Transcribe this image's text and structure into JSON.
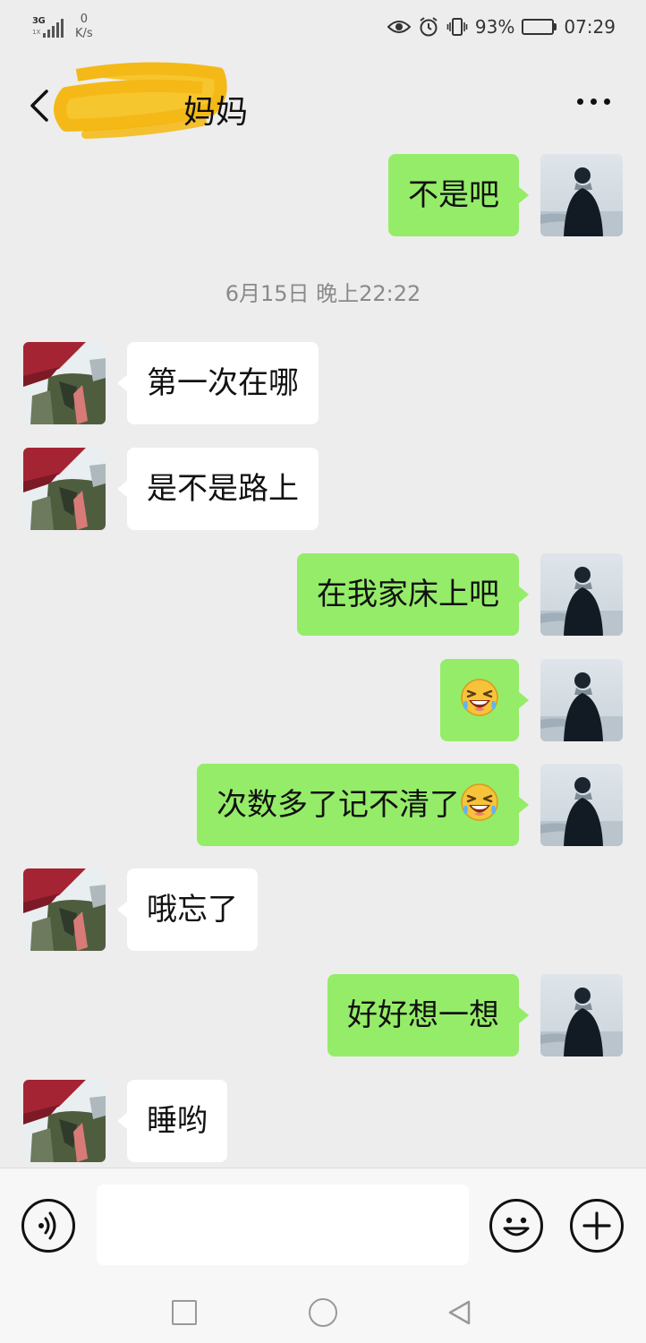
{
  "status_bar": {
    "network": "3G",
    "network_sub": "1X",
    "speed_value": "0",
    "speed_unit": "K/s",
    "battery": "93%",
    "battery_level": 0.93,
    "time": "07:29",
    "icons": [
      "eye-icon",
      "alarm-icon",
      "vibrate-icon",
      "battery-icon"
    ]
  },
  "header": {
    "title": "妈妈",
    "back_icon": "chevron-left-icon",
    "more_icon": "more-dots-icon"
  },
  "chat": {
    "messages": [
      {
        "side": "out",
        "text": "不是吧"
      },
      {
        "side": "in",
        "text": "第一次在哪"
      },
      {
        "side": "in",
        "text": "是不是路上"
      },
      {
        "side": "out",
        "text": "在我家床上吧"
      },
      {
        "side": "out",
        "text": "",
        "emoji": "laughing-emoji"
      },
      {
        "side": "out",
        "text": "次数多了记不清了",
        "emoji": "laughing-emoji"
      },
      {
        "side": "in",
        "text": "哦忘了"
      },
      {
        "side": "out",
        "text": "好好想一想"
      },
      {
        "side": "in",
        "text": "睡哟"
      }
    ],
    "timestamp": "6月15日 晚上22:22"
  },
  "input_bar": {
    "value": "",
    "placeholder": "",
    "icons": [
      "voice-icon",
      "emoji-icon",
      "plus-icon"
    ]
  },
  "system_nav": {
    "icons": [
      "recent-apps-icon",
      "home-icon",
      "back-triangle-icon"
    ]
  },
  "colors": {
    "outgoing_bubble": "#95ec69",
    "incoming_bubble": "#ffffff",
    "background": "#ededed"
  }
}
